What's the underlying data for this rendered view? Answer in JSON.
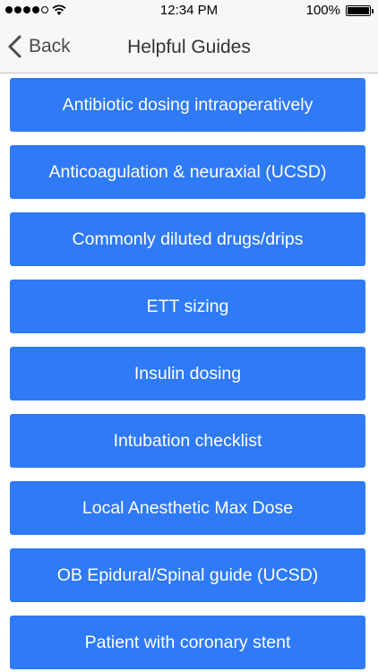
{
  "status_bar": {
    "time": "12:34 PM",
    "battery_percent": "100%",
    "signal_bars_filled": 4,
    "signal_bars_total": 5,
    "battery_level": 1.0
  },
  "nav": {
    "back_label": "Back",
    "title": "Helpful Guides"
  },
  "guides": [
    {
      "label": "Antibiotic dosing intraoperatively"
    },
    {
      "label": "Anticoagulation & neuraxial (UCSD)"
    },
    {
      "label": "Commonly diluted drugs/drips"
    },
    {
      "label": "ETT sizing"
    },
    {
      "label": "Insulin dosing"
    },
    {
      "label": "Intubation checklist"
    },
    {
      "label": "Local Anesthetic Max Dose"
    },
    {
      "label": "OB Epidural/Spinal guide (UCSD)"
    },
    {
      "label": "Patient with coronary stent"
    }
  ],
  "colors": {
    "button_background": "#2f7af6",
    "button_text": "#ffffff",
    "bar_background": "#f7f7f7"
  }
}
